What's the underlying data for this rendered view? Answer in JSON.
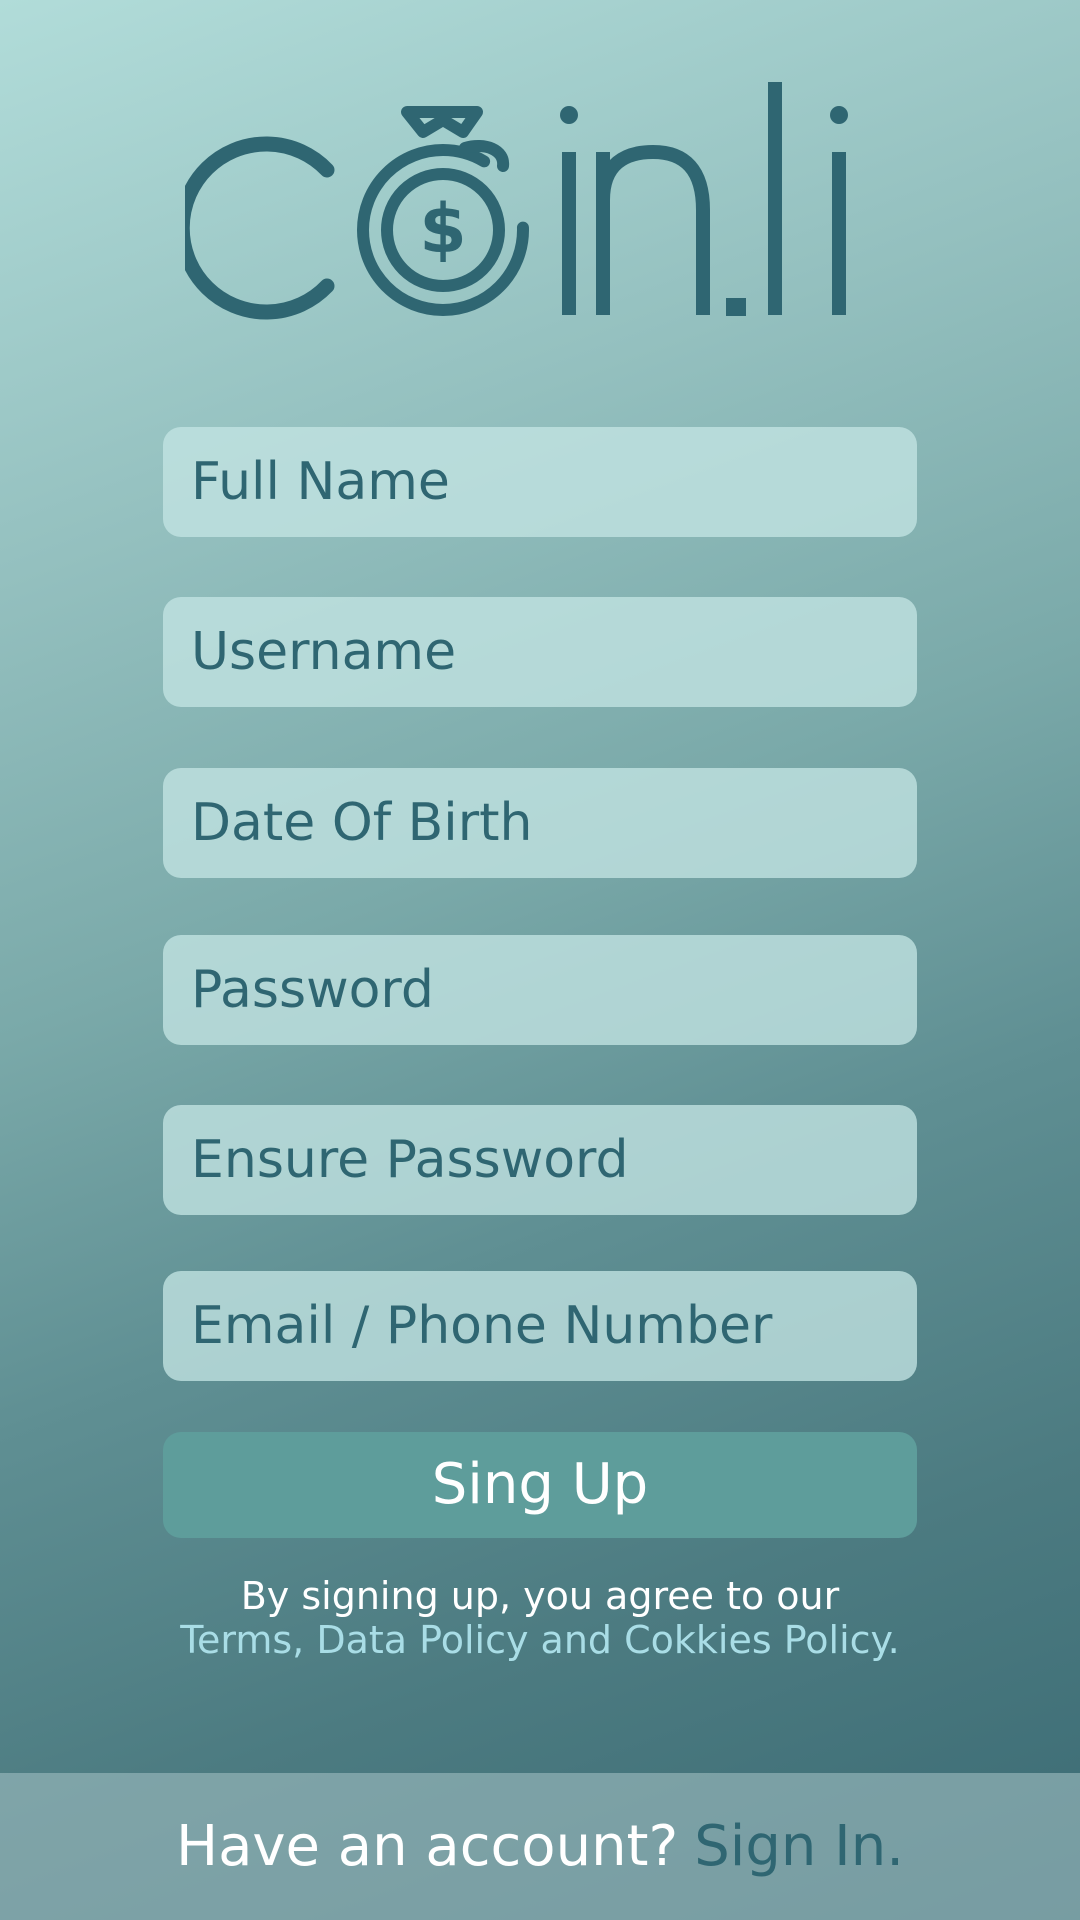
{
  "app": {
    "logo_text": "Coin.li",
    "logo_color": "#2f6672"
  },
  "form": {
    "fields": [
      {
        "placeholder": "Full Name",
        "value": ""
      },
      {
        "placeholder": "Username",
        "value": ""
      },
      {
        "placeholder": "Date Of Birth",
        "value": ""
      },
      {
        "placeholder": "Password",
        "value": ""
      },
      {
        "placeholder": "Ensure Password",
        "value": ""
      },
      {
        "placeholder": "Email / Phone Number",
        "value": ""
      }
    ],
    "submit_label": "Sing Up"
  },
  "terms": {
    "line1": "By signing up, you agree to our",
    "link": "Terms, Data Policy and Cokkies Policy",
    "period": "."
  },
  "footer": {
    "question": "Have an account?",
    "signin_label": "Sign In."
  },
  "colors": {
    "accent_text": "#2f6672",
    "button": "#5e9d9b",
    "link": "#a9dde6"
  },
  "icons": {
    "logo_o": "money-bag-icon"
  }
}
